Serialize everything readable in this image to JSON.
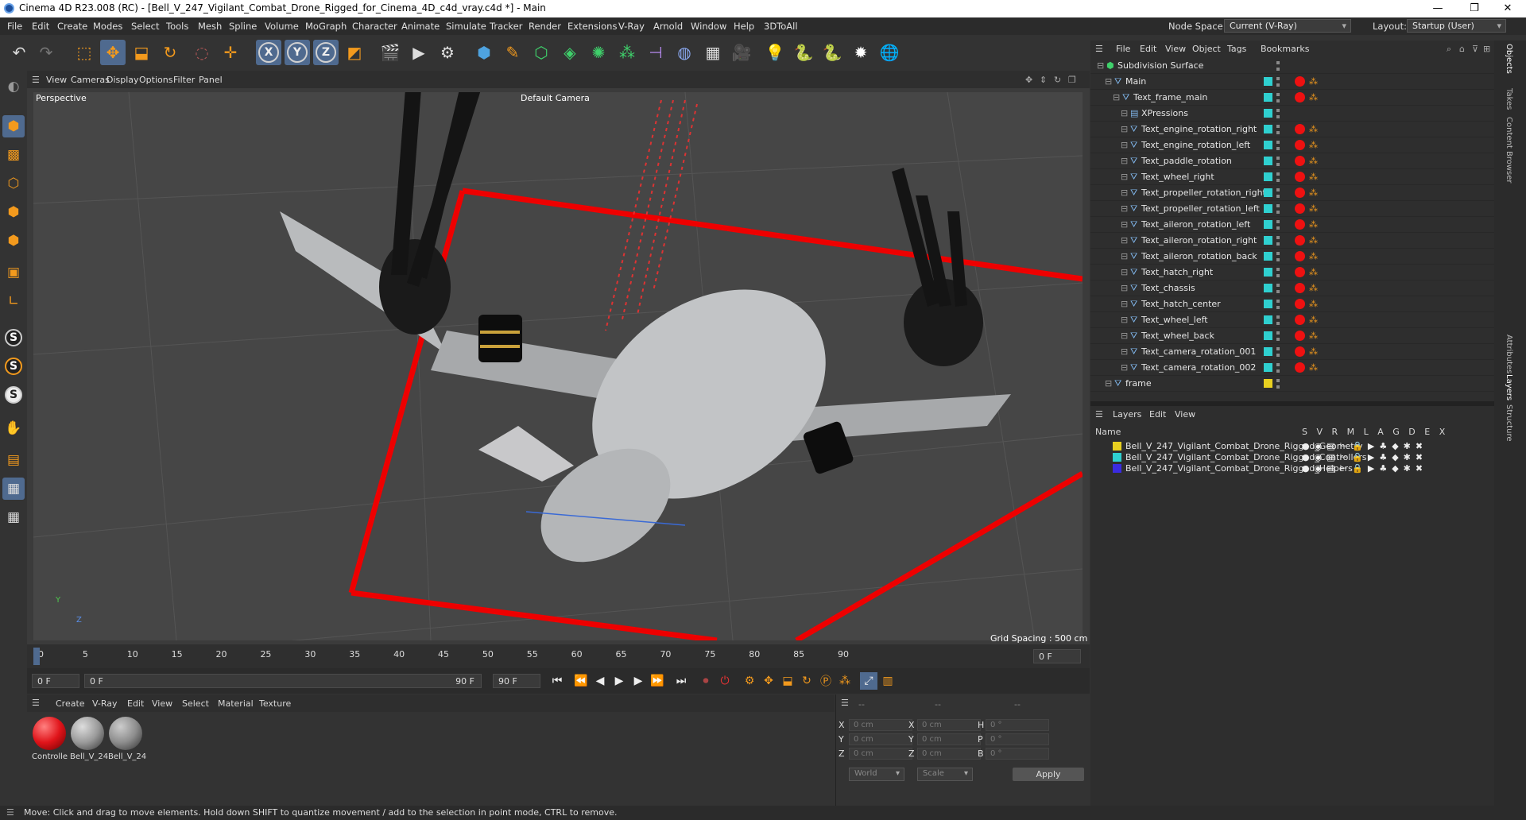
{
  "window": {
    "title": "Cinema 4D R23.008 (RC) - [Bell_V_247_Vigilant_Combat_Drone_Rigged_for_Cinema_4D_c4d_vray.c4d *] - Main",
    "minimize": "—",
    "maximize": "❐",
    "close": "✕"
  },
  "menu": {
    "items": [
      "File",
      "Edit",
      "Create",
      "Modes",
      "Select",
      "Tools",
      "Mesh",
      "Spline",
      "Volume",
      "MoGraph",
      "Character",
      "Animate",
      "Simulate",
      "Tracker",
      "Render",
      "Extensions",
      "V-Ray",
      "Arnold",
      "Window",
      "Help",
      "3DToAll"
    ],
    "node_space_label": "Node Space:",
    "node_space_value": "Current (V-Ray)",
    "layout_label": "Layout:",
    "layout_value": "Startup (User)"
  },
  "toolbar": {
    "axis_x": "X",
    "axis_y": "Y",
    "axis_z": "Z"
  },
  "viewport": {
    "menu": [
      "View",
      "Cameras",
      "Display",
      "Options",
      "Filter",
      "Panel"
    ],
    "name": "Perspective",
    "camera": "Default Camera",
    "grid_spacing": "Grid Spacing : 500 cm",
    "axis_y": "Y",
    "axis_z": "Z"
  },
  "timeline": {
    "ticks": [
      0,
      5,
      10,
      15,
      20,
      25,
      30,
      35,
      40,
      45,
      50,
      55,
      60,
      65,
      70,
      75,
      80,
      85,
      90
    ],
    "current_frame": "0 F",
    "start_field": "0 F",
    "range_start": "0 F",
    "range_end": "90 F",
    "end_field": "90 F"
  },
  "materials": {
    "menu": [
      "Create",
      "V-Ray",
      "Edit",
      "View",
      "Select",
      "Material",
      "Texture"
    ],
    "items": [
      {
        "label": "Controlle",
        "color": "#e0141a"
      },
      {
        "label": "Bell_V_24",
        "color": "#9a9a9a"
      },
      {
        "label": "Bell_V_24",
        "color": "#8d8d8d"
      }
    ]
  },
  "coordinates": {
    "header_dashes": [
      "--",
      "--",
      "--"
    ],
    "rows": [
      {
        "a": "X",
        "av": "0 cm",
        "b": "X",
        "bv": "0 cm",
        "c": "H",
        "cv": "0 °"
      },
      {
        "a": "Y",
        "av": "0 cm",
        "b": "Y",
        "bv": "0 cm",
        "c": "P",
        "cv": "0 °"
      },
      {
        "a": "Z",
        "av": "0 cm",
        "b": "Z",
        "bv": "0 cm",
        "c": "B",
        "cv": "0 °"
      }
    ],
    "space": "World",
    "mode": "Scale",
    "apply": "Apply"
  },
  "status": {
    "text": "Move: Click and drag to move elements. Hold down SHIFT to quantize movement / add to the selection in point mode, CTRL to remove."
  },
  "objects": {
    "menu": [
      "File",
      "Edit",
      "View",
      "Object",
      "Tags",
      "Bookmarks"
    ],
    "rows": [
      {
        "name": "Subdivision Surface",
        "indent": 0,
        "color": "",
        "red": false
      },
      {
        "name": "Main",
        "indent": 1,
        "color": "#2fd0d0",
        "red": true
      },
      {
        "name": "Text_frame_main",
        "indent": 2,
        "color": "#2fd0d0",
        "red": true
      },
      {
        "name": "XPressions",
        "indent": 3,
        "color": "#2fd0d0",
        "red": false
      },
      {
        "name": "Text_engine_rotation_right",
        "indent": 3,
        "color": "#2fd0d0",
        "red": true
      },
      {
        "name": "Text_engine_rotation_left",
        "indent": 3,
        "color": "#2fd0d0",
        "red": true
      },
      {
        "name": "Text_paddle_rotation",
        "indent": 3,
        "color": "#2fd0d0",
        "red": true
      },
      {
        "name": "Text_wheel_right",
        "indent": 3,
        "color": "#2fd0d0",
        "red": true
      },
      {
        "name": "Text_propeller_rotation_right",
        "indent": 3,
        "color": "#2fd0d0",
        "red": true
      },
      {
        "name": "Text_propeller_rotation_left",
        "indent": 3,
        "color": "#2fd0d0",
        "red": true
      },
      {
        "name": "Text_aileron_rotation_left",
        "indent": 3,
        "color": "#2fd0d0",
        "red": true
      },
      {
        "name": "Text_aileron_rotation_right",
        "indent": 3,
        "color": "#2fd0d0",
        "red": true
      },
      {
        "name": "Text_aileron_rotation_back",
        "indent": 3,
        "color": "#2fd0d0",
        "red": true
      },
      {
        "name": "Text_hatch_right",
        "indent": 3,
        "color": "#2fd0d0",
        "red": true
      },
      {
        "name": "Text_chassis",
        "indent": 3,
        "color": "#2fd0d0",
        "red": true
      },
      {
        "name": "Text_hatch_center",
        "indent": 3,
        "color": "#2fd0d0",
        "red": true
      },
      {
        "name": "Text_wheel_left",
        "indent": 3,
        "color": "#2fd0d0",
        "red": true
      },
      {
        "name": "Text_wheel_back",
        "indent": 3,
        "color": "#2fd0d0",
        "red": true
      },
      {
        "name": "Text_camera_rotation_001",
        "indent": 3,
        "color": "#2fd0d0",
        "red": true
      },
      {
        "name": "Text_camera_rotation_002",
        "indent": 3,
        "color": "#2fd0d0",
        "red": true
      },
      {
        "name": "frame",
        "indent": 1,
        "color": "#e8d020",
        "red": false
      }
    ]
  },
  "layers": {
    "menu": [
      "Layers",
      "Edit",
      "View"
    ],
    "name_header": "Name",
    "flag_headers": "S V R M L A G D E X",
    "rows": [
      {
        "name": "Bell_V_247_Vigilant_Combat_Drone_Rigged_Geometry",
        "color": "#e8d020"
      },
      {
        "name": "Bell_V_247_Vigilant_Combat_Drone_Rigged_Controllers",
        "color": "#2fd0d0"
      },
      {
        "name": "Bell_V_247_Vigilant_Combat_Drone_Rigged_Helpers",
        "color": "#3a2be0"
      }
    ]
  },
  "side_tabs": [
    "Objects",
    "Takes",
    "Content Browser",
    "Attributes",
    "Layers",
    "Structure"
  ]
}
